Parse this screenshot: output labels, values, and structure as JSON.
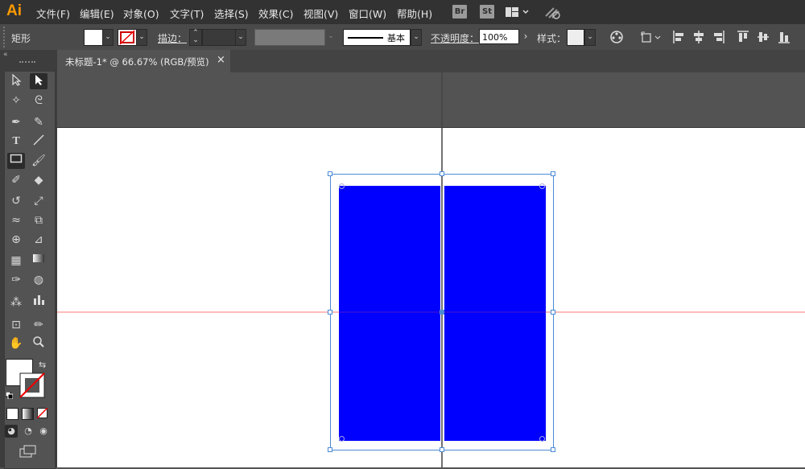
{
  "app": {
    "logo": "Ai"
  },
  "menu": [
    {
      "id": "file",
      "label": "文件(F)"
    },
    {
      "id": "edit",
      "label": "编辑(E)"
    },
    {
      "id": "object",
      "label": "对象(O)"
    },
    {
      "id": "type",
      "label": "文字(T)"
    },
    {
      "id": "select",
      "label": "选择(S)"
    },
    {
      "id": "effect",
      "label": "效果(C)"
    },
    {
      "id": "view",
      "label": "视图(V)"
    },
    {
      "id": "window",
      "label": "窗口(W)"
    },
    {
      "id": "help",
      "label": "帮助(H)"
    }
  ],
  "menubar_buttons": {
    "bridge": "Br",
    "stock": "St"
  },
  "control_bar": {
    "selection_label": "矩形",
    "stroke_label": "描边：",
    "brush_label": "基本",
    "opacity_label": "不透明度：",
    "opacity_value": "100%",
    "style_label": "样式："
  },
  "document": {
    "tab_title": "未标题-1* @ 66.67% (RGB/预览)",
    "close_glyph": "×"
  },
  "colors": {
    "fill": "#0000ff",
    "accent": "#ff9a00",
    "guide": "#ff6a6a",
    "selection": "#4b8bd6"
  }
}
